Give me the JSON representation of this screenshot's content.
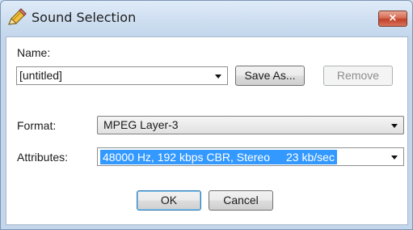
{
  "window": {
    "title": "Sound Selection",
    "close_label": "×"
  },
  "name_section": {
    "label": "Name:",
    "value": "[untitled]",
    "save_as_label": "Save As...",
    "remove_label": "Remove"
  },
  "format": {
    "label": "Format:",
    "value": "MPEG Layer-3"
  },
  "attributes": {
    "label": "Attributes:",
    "value_main": "48000 Hz, 192 kbps CBR, Stereo",
    "value_rate": "23 kb/sec"
  },
  "buttons": {
    "ok_label": "OK",
    "cancel_label": "Cancel"
  },
  "colors": {
    "selection": "#3399ff",
    "close_button": "#c1402a"
  },
  "icons": {
    "title_icon": "pencil-icon",
    "dropdown": "chevron-down-icon"
  }
}
